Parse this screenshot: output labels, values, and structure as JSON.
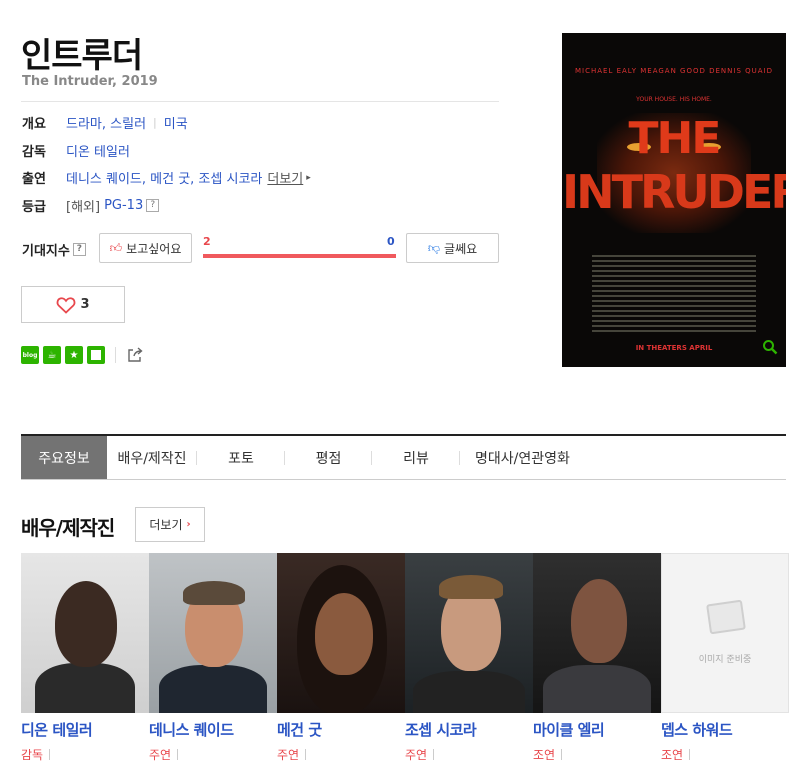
{
  "movie": {
    "title": "인트루더",
    "subtitle": "The Intruder, 2019"
  },
  "info": {
    "overview_key": "개요",
    "genre": "드라마, 스릴러",
    "country": "미국",
    "director_key": "감독",
    "director": "디온 테일러",
    "cast_key": "출연",
    "cast_text": "데니스 퀘이드, 메건 굿, 조셉 시코라",
    "cast_more": "더보기",
    "rating_key": "등급",
    "rating_region": "[해외]",
    "rating": "PG-13",
    "help_mark": "?"
  },
  "expectation": {
    "label": "기대지수",
    "want_label": "보고싶어요",
    "bad_label": "글쎄요",
    "want_count": "2",
    "bad_count": "0",
    "want_ratio": 1.0
  },
  "like": {
    "count": "3"
  },
  "share": {
    "blog_text": "blog"
  },
  "poster": {
    "names": "MICHAEL EALY   MEAGAN GOOD   DENNIS QUAID",
    "tagline": "YOUR HOUSE. HIS HOME.",
    "title_line1": "THE",
    "title_line2": "INTRUDER",
    "bottom": "IN THEATERS APRIL"
  },
  "tabs": [
    {
      "label": "주요정보",
      "active": true
    },
    {
      "label": "배우/제작진",
      "active": false
    },
    {
      "label": "포토",
      "active": false
    },
    {
      "label": "평점",
      "active": false
    },
    {
      "label": "리뷰",
      "active": false
    },
    {
      "label": "명대사/연관영화",
      "active": false
    }
  ],
  "cast_section": {
    "title": "배우/제작진",
    "more": "더보기",
    "members": [
      {
        "name": "디온 테일러",
        "role": "감독"
      },
      {
        "name": "데니스 퀘이드",
        "role": "주연"
      },
      {
        "name": "메건 굿",
        "role": "주연"
      },
      {
        "name": "조셉 시코라",
        "role": "주연"
      },
      {
        "name": "마이클 엘리",
        "role": "조연"
      },
      {
        "name": "뎁스 하워드",
        "role": "조연"
      }
    ],
    "no_image_text": "이미지 준비중"
  },
  "colors": {
    "link": "#2b55c4",
    "accent_red": "#e8474c",
    "naver_green": "#2db400",
    "tab_active": "#737373"
  }
}
